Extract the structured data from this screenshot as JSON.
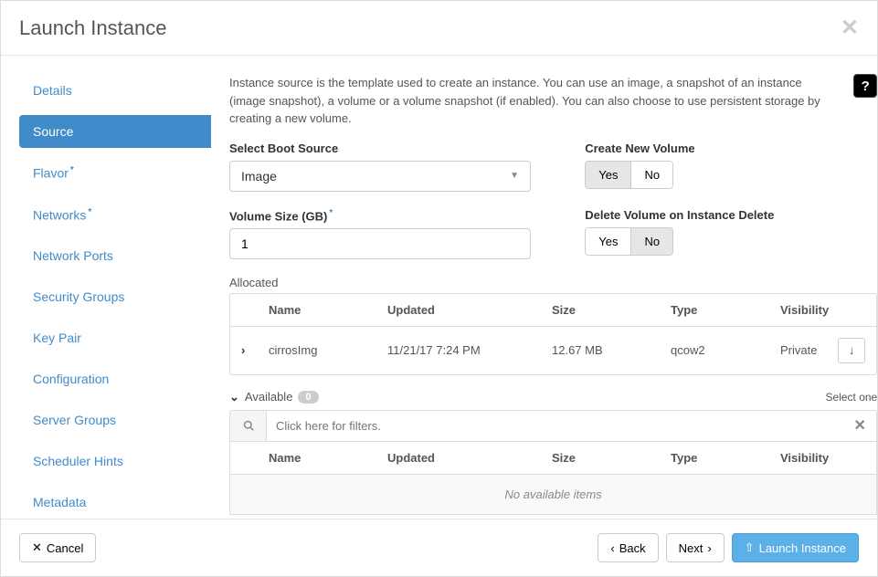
{
  "modal": {
    "title": "Launch Instance"
  },
  "sidebar": {
    "items": [
      {
        "label": "Details",
        "required": false
      },
      {
        "label": "Source",
        "required": false
      },
      {
        "label": "Flavor",
        "required": true
      },
      {
        "label": "Networks",
        "required": true
      },
      {
        "label": "Network Ports",
        "required": false
      },
      {
        "label": "Security Groups",
        "required": false
      },
      {
        "label": "Key Pair",
        "required": false
      },
      {
        "label": "Configuration",
        "required": false
      },
      {
        "label": "Server Groups",
        "required": false
      },
      {
        "label": "Scheduler Hints",
        "required": false
      },
      {
        "label": "Metadata",
        "required": false
      }
    ],
    "activeIndex": 1
  },
  "content": {
    "help_text": "Instance source is the template used to create an instance. You can use an image, a snapshot of an instance (image snapshot), a volume or a volume snapshot (if enabled). You can also choose to use persistent storage by creating a new volume.",
    "boot_source": {
      "label": "Select Boot Source",
      "value": "Image"
    },
    "create_volume": {
      "label": "Create New Volume",
      "yes": "Yes",
      "no": "No",
      "active": "yes"
    },
    "volume_size": {
      "label": "Volume Size (GB)",
      "value": "1"
    },
    "delete_volume": {
      "label": "Delete Volume on Instance Delete",
      "yes": "Yes",
      "no": "No",
      "active": "no"
    },
    "allocated": {
      "label": "Allocated",
      "headers": {
        "name": "Name",
        "updated": "Updated",
        "size": "Size",
        "type": "Type",
        "visibility": "Visibility"
      },
      "rows": [
        {
          "name": "cirrosImg",
          "updated": "11/21/17 7:24 PM",
          "size": "12.67 MB",
          "type": "qcow2",
          "visibility": "Private"
        }
      ]
    },
    "available": {
      "label": "Available",
      "count": "0",
      "select_one": "Select one",
      "filter_placeholder": "Click here for filters.",
      "headers": {
        "name": "Name",
        "updated": "Updated",
        "size": "Size",
        "type": "Type",
        "visibility": "Visibility"
      },
      "no_items": "No available items"
    }
  },
  "footer": {
    "cancel": "Cancel",
    "back": "Back",
    "next": "Next",
    "launch": "Launch Instance"
  }
}
